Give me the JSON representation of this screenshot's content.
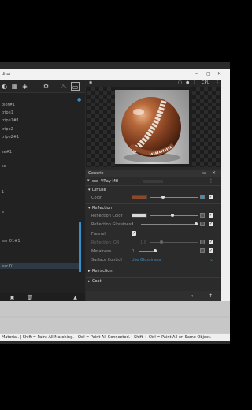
{
  "window": {
    "title_fragment": "ditor"
  },
  "left_panel": {
    "items": [
      "olor#1",
      "tripe1",
      "tripe1#1",
      "tripe2",
      "tripe2#1",
      "se#1",
      "se",
      "1",
      "e",
      "ear 01#1",
      "ear 01"
    ]
  },
  "preview": {
    "cpu_label": "CPU"
  },
  "properties": {
    "tab": "Generic",
    "material_name": "VRay Mtl",
    "sections": {
      "diffuse": "Diffuse",
      "reflection": "Reflection",
      "refraction": "Refraction",
      "coat": "Coat"
    },
    "rows": {
      "color": "Color",
      "reflection_color": "Reflection Color",
      "reflection_glossiness": "Reflection Glossiness",
      "reflection_glossiness_value": "1",
      "fresnel": "Fresnel",
      "reflection_ior": "Reflection IOR",
      "reflection_ior_value": "1.6",
      "metalness": "Metalness",
      "metalness_value": "0",
      "surface_control": "Surface Control",
      "surface_control_value": "Use Glossiness"
    },
    "colors": {
      "diffuse": "#8a4a2a",
      "reflection": "#d9d9d9",
      "accent": "#3a8ec9"
    }
  },
  "status_bar": {
    "text": "Material. | Shift = Paint All Matching. | Ctrl = Paint All Connected. | Shift + Ctrl = Paint All on Same Object."
  }
}
